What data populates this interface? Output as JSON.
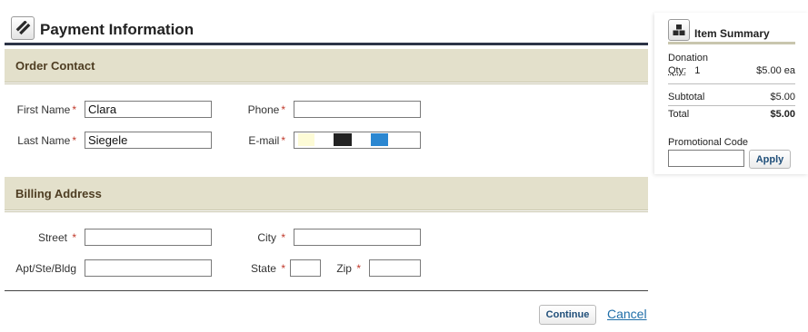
{
  "header": {
    "title": "Payment Information",
    "icon": "pencil-icon"
  },
  "order_contact": {
    "heading": "Order Contact",
    "first_name": {
      "label": "First Name",
      "required": "*",
      "value": "Clara"
    },
    "last_name": {
      "label": "Last Name",
      "required": "*",
      "value": "Siegele"
    },
    "phone": {
      "label": "Phone",
      "required": "*",
      "value": ""
    },
    "email": {
      "label": "E-mail",
      "required": "*",
      "value": ""
    }
  },
  "billing_address": {
    "heading": "Billing Address",
    "street": {
      "label": "Street",
      "required": "*",
      "value": ""
    },
    "city": {
      "label": "City",
      "required": "*",
      "value": ""
    },
    "apt": {
      "label": "Apt/Ste/Bldg",
      "value": ""
    },
    "state": {
      "label": "State",
      "required": "*",
      "value": ""
    },
    "zip": {
      "label": "Zip",
      "required": "*",
      "value": ""
    }
  },
  "actions": {
    "continue_label": "Continue",
    "cancel_label": "Cancel"
  },
  "summary": {
    "title": "Item Summary",
    "icon": "boxes-icon",
    "item_name": "Donation",
    "qty_label": "Qty:",
    "qty_value": "1",
    "unit_price": "$5.00 ea",
    "subtotal_label": "Subtotal",
    "subtotal_value": "$5.00",
    "total_label": "Total",
    "total_value": "$5.00",
    "promo_label": "Promotional Code",
    "promo_value": "",
    "apply_label": "Apply"
  },
  "colors": {
    "section_bar": "#e3e0cb",
    "section_heading": "#4e3d22",
    "header_rule": "#2c3446",
    "link": "#1f6ea8",
    "required": "#c0392b"
  }
}
